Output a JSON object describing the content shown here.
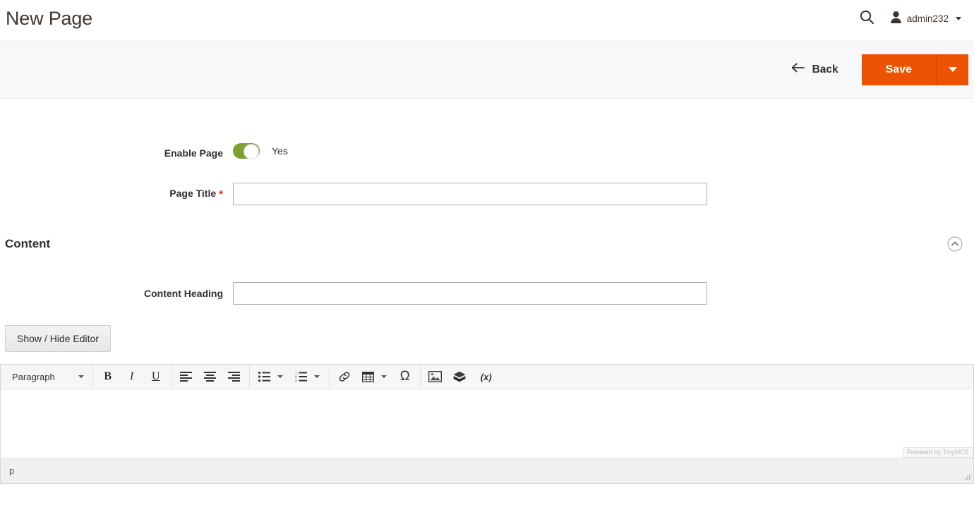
{
  "header": {
    "title": "New Page",
    "search_icon": "search-icon",
    "user_icon": "user-icon",
    "user_name": "admin232",
    "caret_icon": "chevron-down-icon"
  },
  "actions": {
    "back_label": "Back",
    "back_icon": "arrow-left-icon",
    "save_label": "Save",
    "save_menu_icon": "chevron-down-icon",
    "save_color": "#eb5202"
  },
  "form": {
    "enable_page": {
      "label": "Enable Page",
      "value": "Yes",
      "on": true,
      "on_color": "#79a22e"
    },
    "page_title": {
      "label": "Page Title",
      "required_marker": "*",
      "required_color": "#e22626",
      "value": "",
      "placeholder": ""
    }
  },
  "content_section": {
    "title": "Content",
    "collapse_icon": "chevron-up-circle-icon",
    "content_heading": {
      "label": "Content Heading",
      "value": "",
      "placeholder": ""
    },
    "show_hide_editor_label": "Show / Hide Editor"
  },
  "editor": {
    "format_select": {
      "value": "Paragraph",
      "caret_icon": "chevron-down-icon"
    },
    "buttons": [
      {
        "name": "bold-icon",
        "glyph": "B"
      },
      {
        "name": "italic-icon",
        "glyph": "I"
      },
      {
        "name": "underline-icon",
        "glyph": "U"
      },
      {
        "name": "align-left-icon",
        "glyph": ""
      },
      {
        "name": "align-center-icon",
        "glyph": ""
      },
      {
        "name": "align-right-icon",
        "glyph": ""
      },
      {
        "name": "bullet-list-icon",
        "glyph": ""
      },
      {
        "name": "numbered-list-icon",
        "glyph": ""
      },
      {
        "name": "link-icon",
        "glyph": ""
      },
      {
        "name": "table-icon",
        "glyph": ""
      },
      {
        "name": "special-character-icon",
        "glyph": "Ω"
      },
      {
        "name": "insert-image-icon",
        "glyph": ""
      },
      {
        "name": "insert-widget-icon",
        "glyph": ""
      },
      {
        "name": "insert-variable-icon",
        "glyph": "(x)"
      }
    ],
    "content": "",
    "powered_by": "Powered by TinyMCE",
    "status_path": "p",
    "resize_icon": "resize-grip-icon"
  }
}
